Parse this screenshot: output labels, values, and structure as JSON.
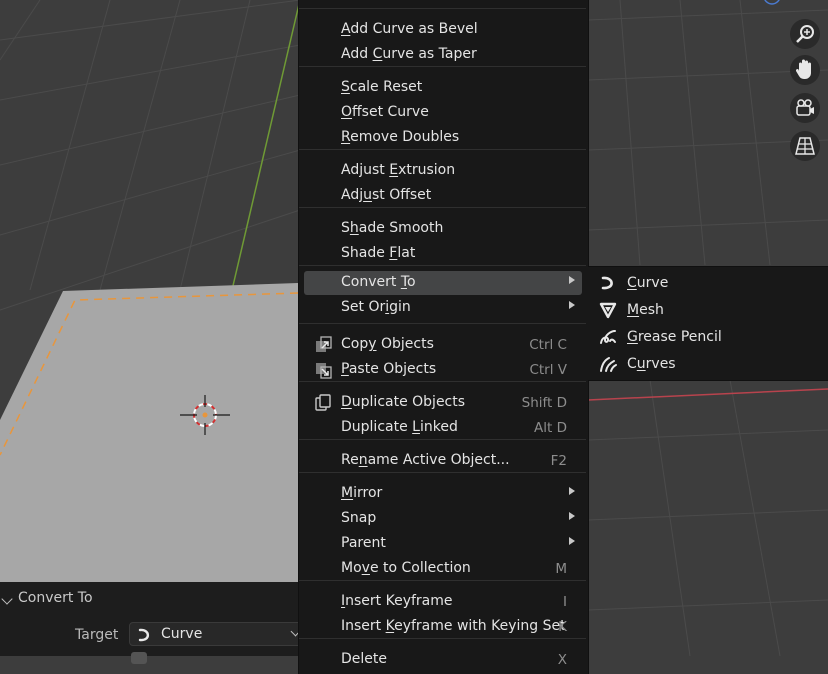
{
  "menu": {
    "items": [
      {
        "pre": "",
        "key": "A",
        "post": "dd Curve as Bevel"
      },
      {
        "pre": "Add ",
        "key": "C",
        "post": "urve as Taper"
      },
      {
        "pre": "",
        "key": "S",
        "post": "cale Reset"
      },
      {
        "pre": "",
        "key": "O",
        "post": "ffset Curve"
      },
      {
        "pre": "",
        "key": "R",
        "post": "emove Doubles"
      },
      {
        "pre": "Adjust ",
        "key": "E",
        "post": "xtrusion"
      },
      {
        "pre": "Adj",
        "key": "u",
        "post": "st Offset"
      },
      {
        "pre": "S",
        "key": "h",
        "post": "ade Smooth"
      },
      {
        "pre": "Shade ",
        "key": "F",
        "post": "lat"
      },
      {
        "pre": "Convert ",
        "key": "T",
        "post": "o"
      },
      {
        "pre": "Set Or",
        "key": "i",
        "post": "gin"
      },
      {
        "pre": "Cop",
        "key": "y",
        "post": " Objects",
        "shortcut": "Ctrl C"
      },
      {
        "pre": "",
        "key": "P",
        "post": "aste Objects",
        "shortcut": "Ctrl V"
      },
      {
        "pre": "",
        "key": "D",
        "post": "uplicate Objects",
        "shortcut": "Shift D"
      },
      {
        "pre": "Duplicate ",
        "key": "L",
        "post": "inked",
        "shortcut": "Alt D"
      },
      {
        "pre": "Re",
        "key": "n",
        "post": "ame Active Object...",
        "shortcut": "F2"
      },
      {
        "pre": "",
        "key": "M",
        "post": "irror"
      },
      {
        "pre": "Snap",
        "key": "",
        "post": ""
      },
      {
        "pre": "Parent",
        "key": "",
        "post": ""
      },
      {
        "pre": "Mo",
        "key": "v",
        "post": "e to Collection",
        "shortcut": "M"
      },
      {
        "pre": "",
        "key": "I",
        "post": "nsert Keyframe",
        "shortcut": "I"
      },
      {
        "pre": "Insert ",
        "key": "K",
        "post": "eyframe with Keying Set",
        "shortcut": "K"
      },
      {
        "pre": "Delete",
        "key": "",
        "post": "",
        "shortcut": "X"
      }
    ]
  },
  "submenu": {
    "items": [
      {
        "pre": "",
        "key": "C",
        "post": "urve",
        "icon": "curve-icon"
      },
      {
        "pre": "",
        "key": "M",
        "post": "esh",
        "icon": "mesh-icon"
      },
      {
        "pre": "",
        "key": "G",
        "post": "rease Pencil",
        "icon": "grease-pencil-icon"
      },
      {
        "pre": "C",
        "key": "u",
        "post": "rves",
        "icon": "curves-icon"
      }
    ]
  },
  "panel": {
    "title": "Convert To",
    "target_label": "Target",
    "target_value": "Curve"
  },
  "colors": {
    "viewport_bg": "#3d3d3d",
    "grid_line": "#4a4a4a",
    "plane": "#a7a7a7",
    "selection_outline": "#e8963c",
    "y_axis": "#6f9a35",
    "x_axis": "#b8434d",
    "menu_bg": "#181818",
    "highlight": "#444546"
  }
}
